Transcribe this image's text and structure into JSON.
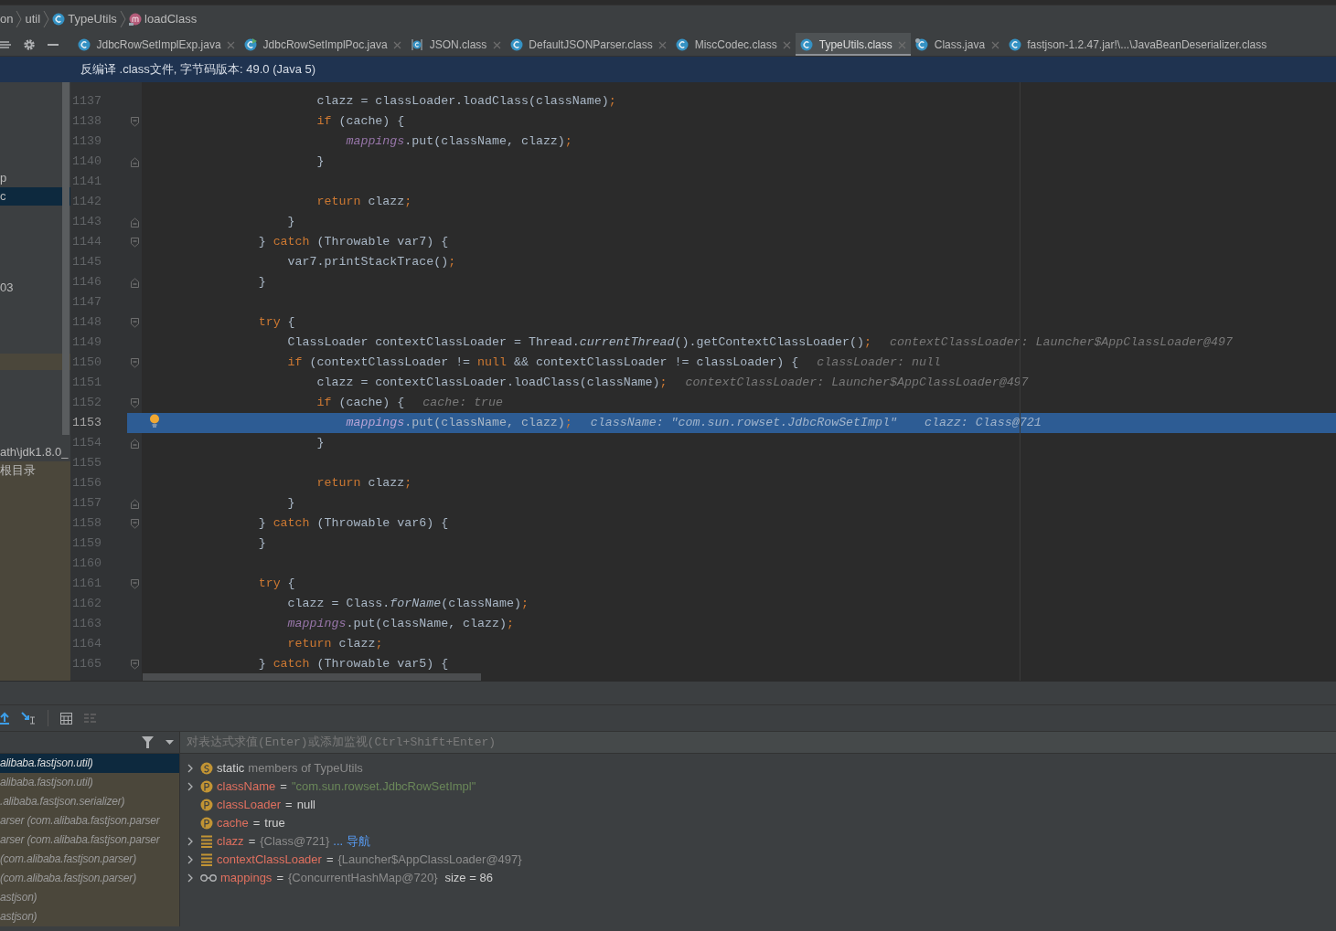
{
  "breadcrumb": [
    {
      "text": "on"
    },
    {
      "text": "util"
    },
    {
      "text": "TypeUtils"
    },
    {
      "text": "loadClass"
    }
  ],
  "tabs": [
    {
      "label": "JdbcRowSetImplExp.java",
      "selected": false
    },
    {
      "label": "JdbcRowSetImplPoc.java",
      "selected": false
    },
    {
      "label": "JSON.class",
      "selected": false
    },
    {
      "label": "DefaultJSONParser.class",
      "selected": false
    },
    {
      "label": "MiscCodec.class",
      "selected": false
    },
    {
      "label": "TypeUtils.class",
      "selected": true
    },
    {
      "label": "Class.java",
      "selected": false
    },
    {
      "label": "fastjson-1.2.47.jar!\\...\\JavaBeanDeserializer.class",
      "selected": false
    }
  ],
  "banner": "反编译 .class文件, 字节码版本: 49.0 (Java 5)",
  "project_tree": [
    {
      "text": "p",
      "selected": false
    },
    {
      "text": "c",
      "selected": true
    },
    {
      "text": "03",
      "selected": false
    },
    {
      "text": "ath\\jdk1.8.0_",
      "selected": false
    },
    {
      "text": "根目录",
      "selected": false
    }
  ],
  "code_lines": [
    {
      "number": "1137",
      "selected": false,
      "tokens": [
        {
          "kind": "plain",
          "text": "                        clazz = classLoader.loadClass(className)"
        },
        {
          "kind": "semi",
          "text": ";"
        }
      ]
    },
    {
      "number": "1138",
      "selected": false,
      "tokens": [
        {
          "kind": "kw",
          "text": "                        if"
        },
        {
          "kind": "plain",
          "text": " (cache) {"
        }
      ]
    },
    {
      "number": "1139",
      "selected": false,
      "tokens": [
        {
          "kind": "field",
          "text": "                            mappings"
        },
        {
          "kind": "plain",
          "text": ".put(className, clazz)"
        },
        {
          "kind": "semi",
          "text": ";"
        }
      ]
    },
    {
      "number": "1140",
      "selected": false,
      "tokens": [
        {
          "kind": "plain",
          "text": "                        }"
        }
      ]
    },
    {
      "number": "1141",
      "selected": false
    },
    {
      "number": "1142",
      "selected": false,
      "tokens": [
        {
          "kind": "kw",
          "text": "                        return"
        },
        {
          "kind": "plain",
          "text": " clazz"
        },
        {
          "kind": "semi",
          "text": ";"
        }
      ]
    },
    {
      "number": "1143",
      "selected": false,
      "tokens": [
        {
          "kind": "plain",
          "text": "                    }"
        }
      ]
    },
    {
      "number": "1144",
      "selected": false,
      "tokens": [
        {
          "kind": "plain",
          "text": "                } "
        },
        {
          "kind": "kw",
          "text": "catch"
        },
        {
          "kind": "plain",
          "text": " (Throwable var7) {"
        }
      ]
    },
    {
      "number": "1145",
      "selected": false,
      "tokens": [
        {
          "kind": "plain",
          "text": "                    var7.printStackTrace()"
        },
        {
          "kind": "semi",
          "text": ";"
        }
      ]
    },
    {
      "number": "1146",
      "selected": false,
      "tokens": [
        {
          "kind": "plain",
          "text": "                }"
        }
      ]
    },
    {
      "number": "1147",
      "selected": false
    },
    {
      "number": "1148",
      "selected": false,
      "tokens": [
        {
          "kind": "kw",
          "text": "                try"
        },
        {
          "kind": "plain",
          "text": " {"
        }
      ]
    },
    {
      "number": "1149",
      "selected": false,
      "tokens": [
        {
          "kind": "plain",
          "text": "                    ClassLoader contextClassLoader = Thread."
        },
        {
          "kind": "static",
          "text": "currentThread"
        },
        {
          "kind": "plain",
          "text": "().getContextClassLoader()"
        },
        {
          "kind": "semi",
          "text": ";"
        }
      ],
      "hints": [
        "contextClassLoader: Launcher$AppClassLoader@497"
      ]
    },
    {
      "number": "1150",
      "selected": false,
      "tokens": [
        {
          "kind": "kw",
          "text": "                    if"
        },
        {
          "kind": "plain",
          "text": " (contextClassLoader != "
        },
        {
          "kind": "kw",
          "text": "null"
        },
        {
          "kind": "plain",
          "text": " && contextClassLoader != classLoader) {"
        }
      ],
      "hints": [
        "classLoader: null"
      ]
    },
    {
      "number": "1151",
      "selected": false,
      "tokens": [
        {
          "kind": "plain",
          "text": "                        clazz = contextClassLoader.loadClass(className)"
        },
        {
          "kind": "semi",
          "text": ";"
        }
      ],
      "hints": [
        "contextClassLoader: Launcher$AppClassLoader@497"
      ]
    },
    {
      "number": "1152",
      "selected": false,
      "tokens": [
        {
          "kind": "kw",
          "text": "                        if"
        },
        {
          "kind": "plain",
          "text": " (cache) {"
        }
      ],
      "hints": [
        "cache: true"
      ]
    },
    {
      "number": "1153",
      "selected": true,
      "bulb": true,
      "tokens": [
        {
          "kind": "field",
          "text": "                            mappings"
        },
        {
          "kind": "plain",
          "text": ".put(className, clazz)"
        },
        {
          "kind": "semi",
          "text": ";"
        }
      ],
      "hints": [
        "className: \"com.sun.rowset.JdbcRowSetImpl\"",
        "clazz: Class@721"
      ]
    },
    {
      "number": "1154",
      "selected": false,
      "tokens": [
        {
          "kind": "plain",
          "text": "                        }"
        }
      ]
    },
    {
      "number": "1155",
      "selected": false
    },
    {
      "number": "1156",
      "selected": false,
      "tokens": [
        {
          "kind": "kw",
          "text": "                        return"
        },
        {
          "kind": "plain",
          "text": " clazz"
        },
        {
          "kind": "semi",
          "text": ";"
        }
      ]
    },
    {
      "number": "1157",
      "selected": false,
      "tokens": [
        {
          "kind": "plain",
          "text": "                    }"
        }
      ]
    },
    {
      "number": "1158",
      "selected": false,
      "tokens": [
        {
          "kind": "plain",
          "text": "                } "
        },
        {
          "kind": "kw",
          "text": "catch"
        },
        {
          "kind": "plain",
          "text": " (Throwable var6) {"
        }
      ]
    },
    {
      "number": "1159",
      "selected": false,
      "tokens": [
        {
          "kind": "plain",
          "text": "                }"
        }
      ]
    },
    {
      "number": "1160",
      "selected": false
    },
    {
      "number": "1161",
      "selected": false,
      "tokens": [
        {
          "kind": "kw",
          "text": "                try"
        },
        {
          "kind": "plain",
          "text": " {"
        }
      ]
    },
    {
      "number": "1162",
      "selected": false,
      "tokens": [
        {
          "kind": "plain",
          "text": "                    clazz = Class."
        },
        {
          "kind": "static",
          "text": "forName"
        },
        {
          "kind": "plain",
          "text": "(className)"
        },
        {
          "kind": "semi",
          "text": ";"
        }
      ]
    },
    {
      "number": "1163",
      "selected": false,
      "tokens": [
        {
          "kind": "field",
          "text": "                    mappings"
        },
        {
          "kind": "plain",
          "text": ".put(className, clazz)"
        },
        {
          "kind": "semi",
          "text": ";"
        }
      ]
    },
    {
      "number": "1164",
      "selected": false,
      "tokens": [
        {
          "kind": "kw",
          "text": "                    return"
        },
        {
          "kind": "plain",
          "text": " clazz"
        },
        {
          "kind": "semi",
          "text": ";"
        }
      ]
    },
    {
      "number": "1165",
      "selected": false,
      "tokens": [
        {
          "kind": "plain",
          "text": "                } "
        },
        {
          "kind": "kw",
          "text": "catch"
        },
        {
          "kind": "plain",
          "text": " (Throwable var5) {"
        }
      ]
    }
  ],
  "frames": [
    {
      "text": "alibaba.fastjson.util)",
      "selected": true
    },
    {
      "text": "alibaba.fastjson.util)",
      "selected": false
    },
    {
      "text": ".alibaba.fastjson.serializer)",
      "selected": false
    },
    {
      "text": "arser (com.alibaba.fastjson.parser",
      "selected": false
    },
    {
      "text": "arser (com.alibaba.fastjson.parser",
      "selected": false
    },
    {
      "text": "(com.alibaba.fastjson.parser)",
      "selected": false
    },
    {
      "text": "(com.alibaba.fastjson.parser)",
      "selected": false
    },
    {
      "text": "astjson)",
      "selected": false
    },
    {
      "text": "astjson)",
      "selected": false
    }
  ],
  "evaluate": {
    "placeholder": "对表达式求值(Enter)或添加监视(Ctrl+Shift+Enter)"
  },
  "variables": [
    {
      "kind": "static",
      "expandable": true,
      "name": "static",
      "value": "members of TypeUtils"
    },
    {
      "kind": "string",
      "expandable": true,
      "name": "className",
      "separator": "=",
      "value": "\"com.sun.rowset.JdbcRowSetImpl\""
    },
    {
      "kind": "param",
      "expandable": false,
      "name": "classLoader",
      "separator": "=",
      "value": "null"
    },
    {
      "kind": "param",
      "expandable": false,
      "name": "cache",
      "separator": "=",
      "value": "true"
    },
    {
      "kind": "field",
      "expandable": true,
      "name": "clazz",
      "separator": "=",
      "value": "{Class@721}",
      "link": "... 导航"
    },
    {
      "kind": "field",
      "expandable": true,
      "name": "contextClassLoader",
      "separator": "=",
      "value": "{Launcher$AppClassLoader@497}"
    },
    {
      "kind": "watch",
      "expandable": true,
      "name": "mappings",
      "separator": "=",
      "value": "{ConcurrentHashMap@720}",
      "extra": "size = 86"
    }
  ]
}
